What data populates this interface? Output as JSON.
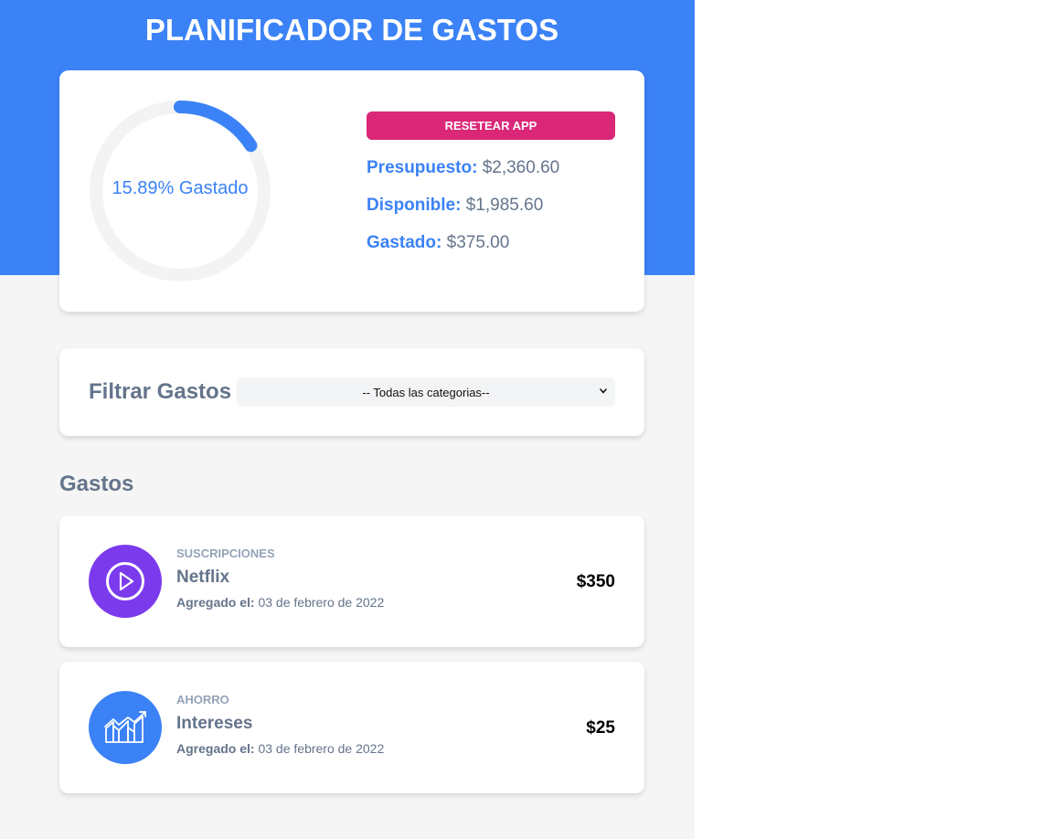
{
  "app": {
    "title": "PLANIFICADOR DE GASTOS"
  },
  "budget": {
    "percent_spent": 15.89,
    "percent_label": "15.89% Gastado",
    "reset_label": "RESETEAR APP",
    "presupuesto_label": "Presupuesto:",
    "presupuesto_value": "$2,360.60",
    "disponible_label": "Disponible:",
    "disponible_value": "$1,985.60",
    "gastado_label": "Gastado:",
    "gastado_value": "$375.00"
  },
  "filter": {
    "label": "Filtrar Gastos",
    "selected": "-- Todas las categorias--"
  },
  "expenses_title": "Gastos",
  "expenses": [
    {
      "category": "SUSCRIPCIONES",
      "name": "Netflix",
      "date_label": "Agregado el:",
      "date": "03 de febrero de 2022",
      "amount": "$350",
      "icon": "play-icon",
      "icon_color": "#7c3aed"
    },
    {
      "category": "AHORRO",
      "name": "Intereses",
      "date_label": "Agregado el:",
      "date": "03 de febrero de 2022",
      "amount": "$25",
      "icon": "savings-chart-icon",
      "icon_color": "#3b82f6"
    }
  ],
  "colors": {
    "primary": "#3b82f6",
    "accent": "#db2777",
    "ring_track": "#f3f3f3",
    "background": "#f5f5f5"
  }
}
